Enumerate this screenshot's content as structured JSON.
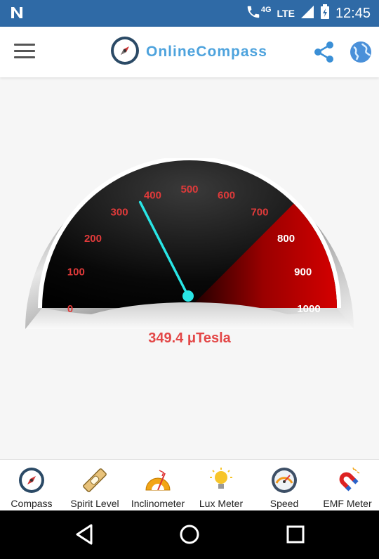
{
  "status_bar": {
    "network_label": "4G",
    "network_type": "LTE",
    "time": "12:45"
  },
  "app_bar": {
    "title": "OnlineCompass"
  },
  "gauge": {
    "min": 0,
    "max": 1000,
    "tick_labels": [
      "0",
      "100",
      "200",
      "300",
      "400",
      "500",
      "600",
      "700",
      "800",
      "900",
      "1000"
    ],
    "value": 349.4,
    "reading_text": "349.4 μTesla",
    "needle_color": "#29e6e6"
  },
  "bottom_nav": {
    "items": [
      {
        "label": "Compass",
        "icon": "compass-icon"
      },
      {
        "label": "Spirit Level",
        "icon": "spirit-level-icon"
      },
      {
        "label": "Inclinometer",
        "icon": "inclinometer-icon"
      },
      {
        "label": "Lux Meter",
        "icon": "lightbulb-icon"
      },
      {
        "label": "Speed",
        "icon": "speedometer-icon"
      },
      {
        "label": "EMF Meter",
        "icon": "magnet-icon"
      }
    ]
  },
  "colors": {
    "status_bar": "#2f6aa6",
    "title": "#4ea3dd",
    "reading": "#e34747",
    "gauge_red": "#cc0000"
  }
}
